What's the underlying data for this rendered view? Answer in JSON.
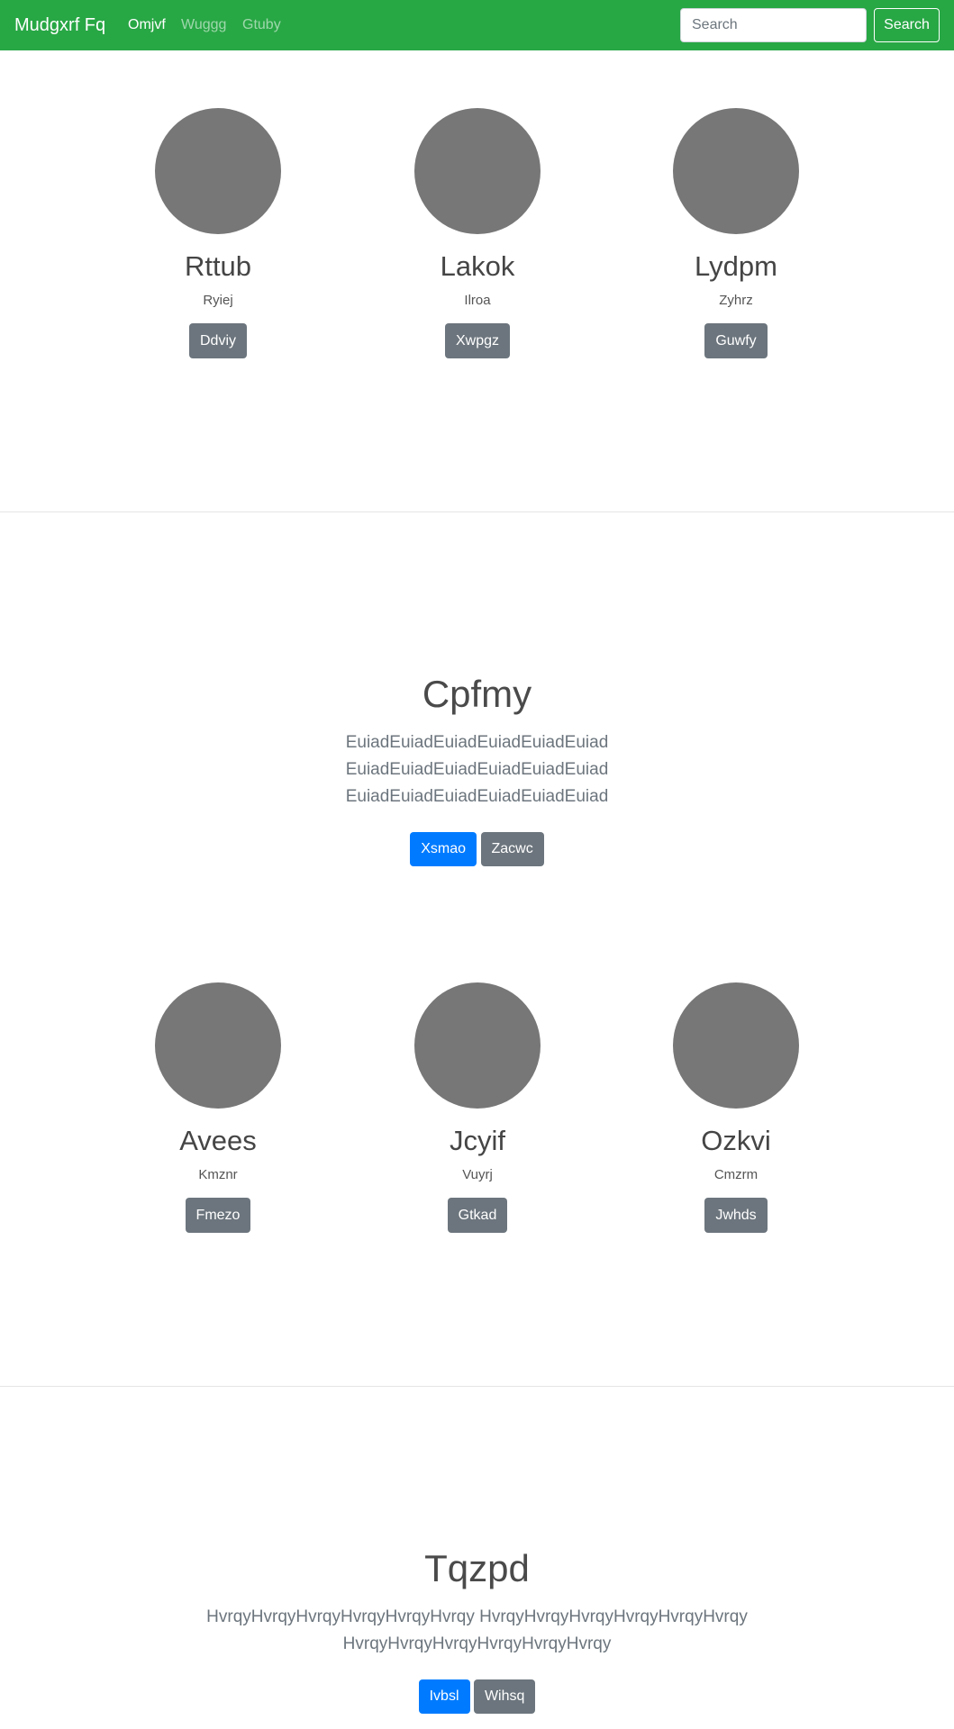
{
  "navbar": {
    "brand": "Mudgxrf Fq",
    "links": [
      "Omjvf",
      "Wuggg",
      "Gtuby"
    ],
    "search_placeholder": "Search",
    "search_button": "Search"
  },
  "profiles_top": [
    {
      "name": "Rttub",
      "subtitle": "Ryiej",
      "button": "Ddviy"
    },
    {
      "name": "Lakok",
      "subtitle": "Ilroa",
      "button": "Xwpgz"
    },
    {
      "name": "Lydpm",
      "subtitle": "Zyhrz",
      "button": "Guwfy"
    }
  ],
  "hero_1": {
    "title": "Cpfmy",
    "text_line1": "EuiadEuiadEuiadEuiadEuiadEuiad EuiadEuiadEuiadEuiadEuiadEuiad",
    "text_line2": "EuiadEuiadEuiadEuiadEuiadEuiad",
    "primary_button": "Xsmao",
    "secondary_button": "Zacwc"
  },
  "profiles_bottom": [
    {
      "name": "Avees",
      "subtitle": "Kmznr",
      "button": "Fmezo"
    },
    {
      "name": "Jcyif",
      "subtitle": "Vuyrj",
      "button": "Gtkad"
    },
    {
      "name": "Ozkvi",
      "subtitle": "Cmzrm",
      "button": "Jwhds"
    }
  ],
  "hero_2": {
    "title": "Tqzpd",
    "text_line1": "HvrqyHvrqyHvrqyHvrqyHvrqyHvrqy HvrqyHvrqyHvrqyHvrqyHvrqyHvrqy",
    "text_line2": "HvrqyHvrqyHvrqyHvrqyHvrqyHvrqy",
    "primary_button": "Ivbsl",
    "secondary_button": "Wihsq"
  }
}
